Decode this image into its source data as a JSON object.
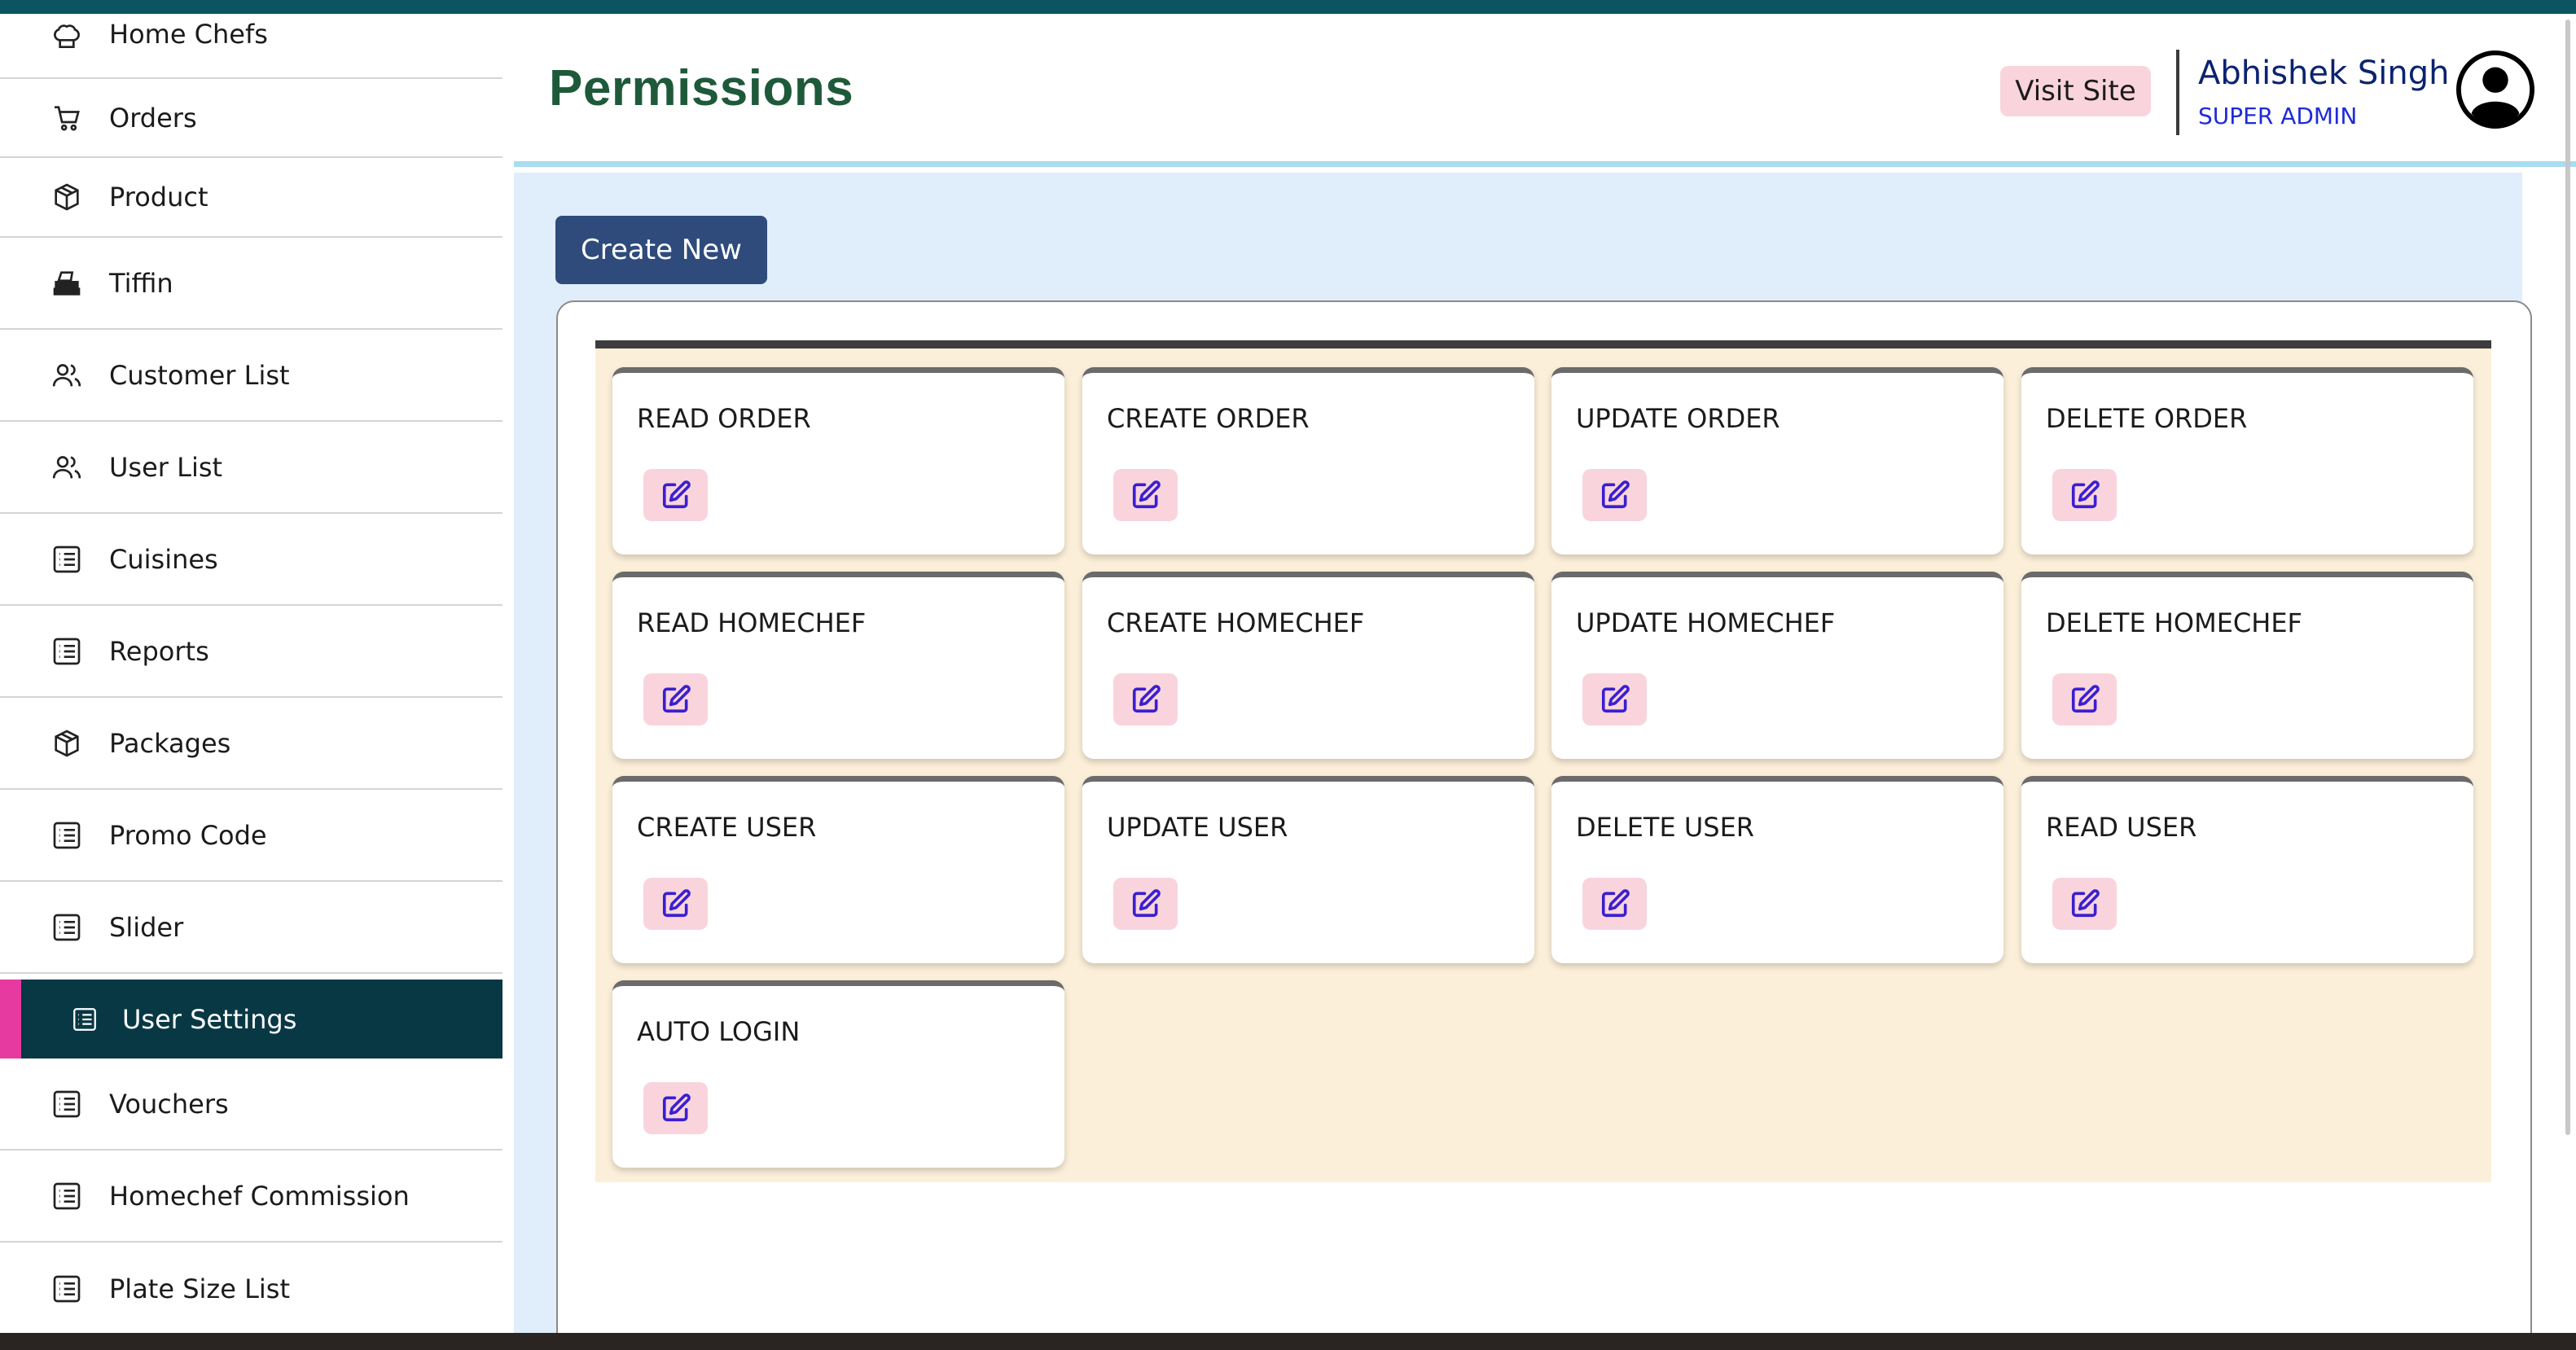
{
  "sidebar": {
    "items": [
      {
        "label": "Home Chefs",
        "icon": "chef-hat-icon"
      },
      {
        "label": "Orders",
        "icon": "cart-icon"
      },
      {
        "label": "Product",
        "icon": "box-icon"
      },
      {
        "label": "Tiffin",
        "icon": "tiffin-icon"
      },
      {
        "label": "Customer List",
        "icon": "users-icon"
      },
      {
        "label": "User List",
        "icon": "users-icon"
      },
      {
        "label": "Cuisines",
        "icon": "list-icon"
      },
      {
        "label": "Reports",
        "icon": "list-icon"
      },
      {
        "label": "Packages",
        "icon": "box-icon"
      },
      {
        "label": "Promo Code",
        "icon": "list-icon"
      },
      {
        "label": "Slider",
        "icon": "list-icon"
      },
      {
        "label": "User Settings",
        "icon": "list-icon",
        "active": true
      },
      {
        "label": "Vouchers",
        "icon": "list-icon"
      },
      {
        "label": "Homechef Commission",
        "icon": "list-icon"
      },
      {
        "label": "Plate Size List",
        "icon": "list-icon"
      }
    ]
  },
  "header": {
    "title": "Permissions",
    "visit_site_label": "Visit Site",
    "user_name": "Abhishek Singh",
    "user_role": "SUPER ADMIN"
  },
  "main": {
    "create_new_label": "Create New",
    "permissions": [
      {
        "name": "READ ORDER"
      },
      {
        "name": "CREATE ORDER"
      },
      {
        "name": "UPDATE ORDER"
      },
      {
        "name": "DELETE ORDER"
      },
      {
        "name": "READ HOMECHEF"
      },
      {
        "name": "CREATE HOMECHEF"
      },
      {
        "name": "UPDATE HOMECHEF"
      },
      {
        "name": "DELETE HOMECHEF"
      },
      {
        "name": "CREATE USER"
      },
      {
        "name": "UPDATE USER"
      },
      {
        "name": "DELETE USER"
      },
      {
        "name": "READ USER"
      },
      {
        "name": "AUTO LOGIN"
      }
    ]
  },
  "colors": {
    "top_bar": "#0b5563",
    "active_nav": "#093845",
    "active_accent": "#e63aa0",
    "title_green": "#1e5a3a",
    "create_button": "#2e4b7c",
    "pink_button": "#f9d4dd",
    "main_background": "#e0edfb",
    "grid_background": "#fcefd9"
  }
}
